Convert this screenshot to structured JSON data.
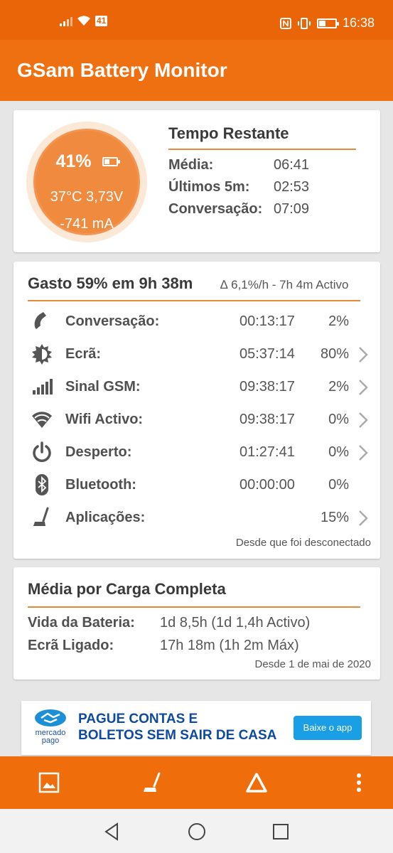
{
  "status_bar": {
    "left_badge": "41",
    "battery_badge": "41",
    "battery_level": 0.41,
    "time": "16:38",
    "icons": [
      "signal-icon",
      "wifi-icon",
      "nfc-icon",
      "vibrate-icon",
      "battery-icon"
    ]
  },
  "app_bar": {
    "title": "GSam Battery Monitor"
  },
  "battery": {
    "percent": "41%",
    "level": 0.41,
    "temp_voltage": "37°C  3,73V",
    "current": "-741 mA"
  },
  "time_remaining": {
    "title": "Tempo Restante",
    "rows": [
      {
        "label": "Média:",
        "value": "06:41"
      },
      {
        "label": "Últimos 5m:",
        "value": "02:53"
      },
      {
        "label": "Conversação:",
        "value": "07:09"
      }
    ]
  },
  "usage": {
    "title": "Gasto 59% em 9h 38m",
    "subtitle": "∆ 6,1%/h - 7h 4m Activo",
    "rows": [
      {
        "icon": "phone-icon",
        "label": "Conversação:",
        "time": "00:13:17",
        "percent": "2%",
        "chevron": false
      },
      {
        "icon": "screen-brightness-icon",
        "label": "Ecrã:",
        "time": "05:37:14",
        "percent": "80%",
        "chevron": true
      },
      {
        "icon": "cell-signal-icon",
        "label": "Sinal GSM:",
        "time": "09:38:17",
        "percent": "2%",
        "chevron": true
      },
      {
        "icon": "wifi-icon",
        "label": "Wifi Activo:",
        "time": "09:38:17",
        "percent": "0%",
        "chevron": true
      },
      {
        "icon": "power-icon",
        "label": "Desperto:",
        "time": "01:27:41",
        "percent": "0%",
        "chevron": true
      },
      {
        "icon": "bluetooth-icon",
        "label": "Bluetooth:",
        "time": "00:00:00",
        "percent": "0%",
        "chevron": false
      },
      {
        "icon": "apps-icon",
        "label": "Aplicações:",
        "time": "",
        "percent": "15%",
        "chevron": true
      }
    ],
    "footer": "Desde que foi desconectado"
  },
  "average": {
    "title": "Média por Carga Completa",
    "rows": [
      {
        "label": "Vida da Bateria:",
        "value": "1d 8,5h (1d 1,4h Activo)"
      },
      {
        "label": "Ecrã Ligado:",
        "value": "17h 18m (1h 2m Máx)"
      }
    ],
    "footer": "Desde 1 de mai de 2020"
  },
  "ad": {
    "brand_line1": "mercado",
    "brand_line2": "pago",
    "text_line1": "PAGUE CONTAS E",
    "text_line2": "BOLETOS SEM SAIR DE CASA",
    "button": "Baixe o app"
  },
  "bottom_bar": {
    "icons": [
      "image-icon",
      "apps-icon",
      "delta-icon",
      "more-vertical-icon"
    ]
  },
  "nav_bar": {
    "icons": [
      "back-icon",
      "home-icon",
      "recents-icon"
    ]
  },
  "colors": {
    "primary": "#ef7010",
    "status": "#ea6508",
    "accent_rule": "#e6893a",
    "gauge": "#f08a3e",
    "ad_blue": "#0d4aa0",
    "ad_button": "#1a9fe6"
  }
}
